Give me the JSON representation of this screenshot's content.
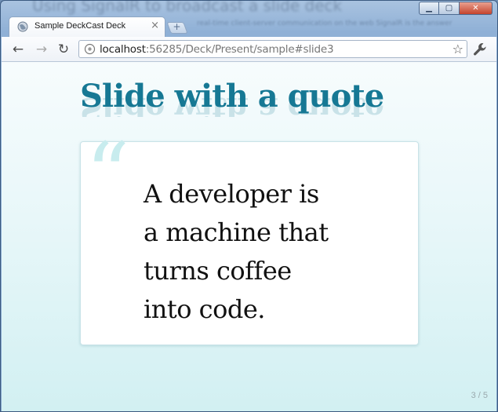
{
  "window": {
    "background_title": "Using SignalR to broadcast a slide deck",
    "background_subtitle": "real-time client-server communication on the web SignalR is the answer"
  },
  "tab": {
    "title": "Sample DeckCast Deck",
    "close_glyph": "×",
    "new_tab_glyph": "+"
  },
  "toolbar": {
    "back_glyph": "←",
    "forward_glyph": "→",
    "reload_glyph": "↻",
    "url_host": "localhost",
    "url_rest": ":56285/Deck/Present/sample#slide3",
    "star_glyph": "☆"
  },
  "slide": {
    "title": "Slide with a quote",
    "quote_mark": "“",
    "quote_lines": [
      "A developer is",
      "a machine that",
      "turns coffee",
      "into code."
    ],
    "counter": "3 / 5"
  },
  "colors": {
    "title": "#167894",
    "quote_mark": "#c8ecee",
    "page_bg": "#e8f7f9"
  }
}
